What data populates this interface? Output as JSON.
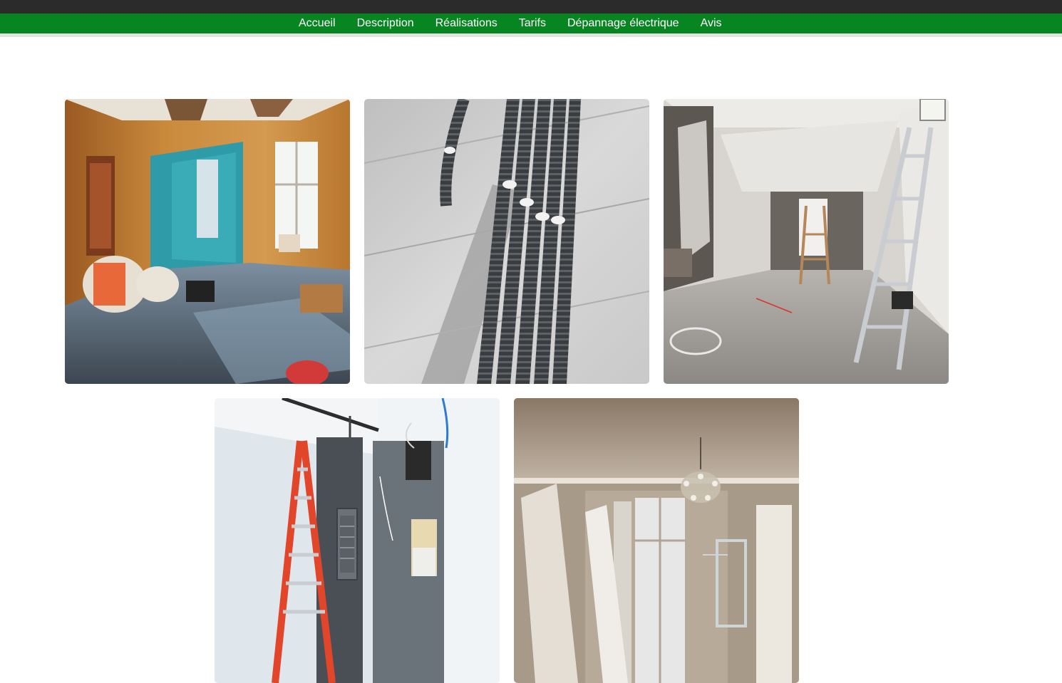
{
  "nav": {
    "items": [
      {
        "label": "Accueil"
      },
      {
        "label": "Description"
      },
      {
        "label": "Réalisations"
      },
      {
        "label": "Tarifs"
      },
      {
        "label": "Dépannage électrique"
      },
      {
        "label": "Avis"
      }
    ]
  },
  "colors": {
    "topbar": "#2b2b2b",
    "nav": "#078521",
    "nav_text": "#ffffff"
  },
  "gallery": {
    "photos": [
      {
        "name": "photo-renovation-room-peeling-walls"
      },
      {
        "name": "photo-electrical-conduits-on-wall"
      },
      {
        "name": "photo-renovation-room-ladder"
      },
      {
        "name": "photo-electrical-panel-ladder"
      },
      {
        "name": "photo-room-chandelier-windows"
      }
    ]
  }
}
